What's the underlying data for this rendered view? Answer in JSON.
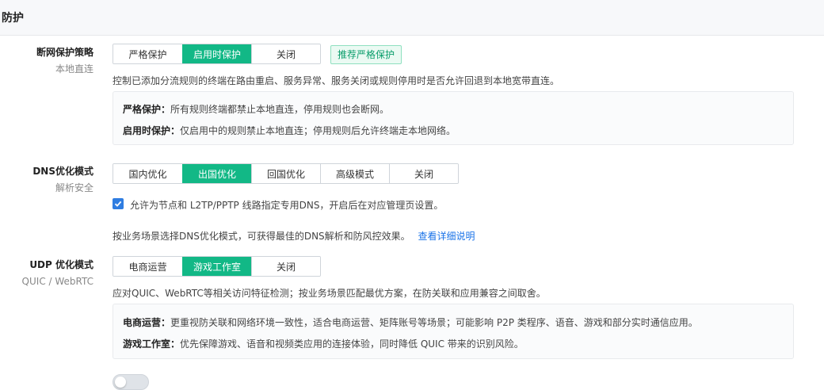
{
  "section": {
    "title": "防护"
  },
  "network_protection": {
    "label": "断网保护策略",
    "sublabel": "本地直连",
    "options": [
      "严格保护",
      "启用时保护",
      "关闭"
    ],
    "selected": "启用时保护",
    "recommend_tag": "推荐严格保护",
    "description": "控制已添加分流规则的终端在路由重启、服务异常、服务关闭或规则停用时是否允许回退到本地宽带直连。",
    "notes": [
      {
        "title": "严格保护：",
        "text": "所有规则终端都禁止本地直连，停用规则也会断网。"
      },
      {
        "title": "启用时保护：",
        "text": "仅启用中的规则禁止本地直连；停用规则后允许终端走本地网络。"
      }
    ]
  },
  "dns_mode": {
    "label": "DNS优化模式",
    "sublabel": "解析安全",
    "options": [
      "国内优化",
      "出国优化",
      "回国优化",
      "高级模式",
      "关闭"
    ],
    "selected": "出国优化",
    "checkbox_label": "允许为节点和 L2TP/PPTP 线路指定专用DNS，开启后在对应管理页设置。",
    "checkbox_checked": true,
    "description": "按业务场景选择DNS优化模式，可获得最佳的DNS解析和防风控效果。",
    "link_text": "查看详细说明"
  },
  "udp_mode": {
    "label": "UDP 优化模式",
    "sublabel": "QUIC / WebRTC",
    "options": [
      "电商运营",
      "游戏工作室",
      "关闭"
    ],
    "selected": "游戏工作室",
    "description": "应对QUIC、WebRTC等相关访问特征检测；按业务场景匹配最优方案，在防关联和应用兼容之间取舍。",
    "notes": [
      {
        "title": "电商运营：",
        "text": "更重视防关联和网络环境一致性，适合电商运营、矩阵账号等场景；可能影响 P2P 类程序、语音、游戏和部分实时通信应用。"
      },
      {
        "title": "游戏工作室：",
        "text": "优先保障游戏、语音和视频类应用的连接体验，同时降低 QUIC 带来的识别风险。"
      }
    ]
  },
  "colors": {
    "accent": "#12b886",
    "link": "#1a73e8",
    "checkbox": "#2f7de1"
  },
  "icons": {
    "checkbox": "check-icon"
  }
}
